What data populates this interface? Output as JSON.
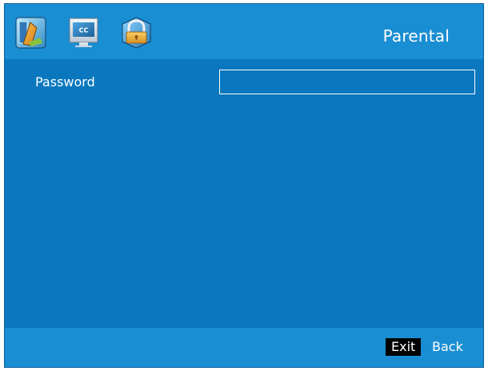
{
  "header": {
    "title": "Parental",
    "icons": [
      {
        "name": "picture-settings-icon"
      },
      {
        "name": "closed-caption-icon",
        "text": "CC"
      },
      {
        "name": "parental-lock-icon"
      }
    ]
  },
  "form": {
    "password_label": "Password",
    "password_value": ""
  },
  "footer": {
    "exit_label": "Exit",
    "back_label": "Back"
  },
  "colors": {
    "header_bg": "#1a8ed3",
    "body_bg": "#0a77bf",
    "text": "#ffffff",
    "key_bg": "#000000"
  }
}
